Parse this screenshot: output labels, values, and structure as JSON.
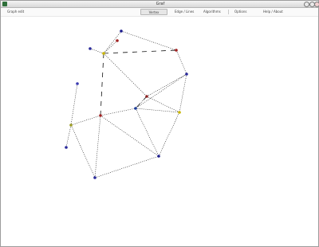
{
  "window": {
    "title": "Graf",
    "controls": [
      "minimize",
      "maximize",
      "close"
    ]
  },
  "toolbar": {
    "left_label": "Graph edit",
    "buttons": [
      {
        "label": "Vertex",
        "active": true
      },
      {
        "label": "Edge / Lines",
        "active": false
      },
      {
        "label": "Algorithms",
        "active": false
      },
      {
        "label": "Options",
        "active": false
      },
      {
        "label": "Help / About",
        "active": false
      }
    ]
  },
  "graph": {
    "vertices": [
      {
        "id": "v1",
        "color": "#1a1a8c"
      },
      {
        "id": "v2",
        "color": "#2a2a9a"
      },
      {
        "id": "v3",
        "color": "#c8b400"
      },
      {
        "id": "v4",
        "color": "#a02020"
      },
      {
        "id": "v5",
        "color": "#a02020"
      },
      {
        "id": "v6",
        "color": "#2a2a9a"
      },
      {
        "id": "v7",
        "color": "#3a3ab0"
      },
      {
        "id": "v8",
        "color": "#8a2020"
      },
      {
        "id": "v9",
        "color": "#1a3a9a"
      },
      {
        "id": "v10",
        "color": "#c8b400"
      },
      {
        "id": "v11",
        "color": "#a02020"
      },
      {
        "id": "v12",
        "color": "#9a9a20"
      },
      {
        "id": "v13",
        "color": "#2a2a9a"
      },
      {
        "id": "v14",
        "color": "#2a2a9a"
      },
      {
        "id": "v15",
        "color": "#1a1a8c"
      }
    ],
    "edges": [
      {
        "from": "v1",
        "to": "v5",
        "style": "dotted"
      },
      {
        "from": "v1",
        "to": "v3",
        "style": "dotted"
      },
      {
        "from": "v4",
        "to": "v3",
        "style": "dotted"
      },
      {
        "from": "v2",
        "to": "v3",
        "style": "dotted"
      },
      {
        "from": "v3",
        "to": "v5",
        "style": "dashed"
      },
      {
        "from": "v3",
        "to": "v11",
        "style": "dashed"
      },
      {
        "from": "v3",
        "to": "v8",
        "style": "dotted"
      },
      {
        "from": "v5",
        "to": "v6",
        "style": "dotted"
      },
      {
        "from": "v6",
        "to": "v10",
        "style": "dotted"
      },
      {
        "from": "v6",
        "to": "v9",
        "style": "dotted"
      },
      {
        "from": "v10",
        "to": "v15",
        "style": "dotted"
      },
      {
        "from": "v7",
        "to": "v12",
        "style": "dotted"
      },
      {
        "from": "v12",
        "to": "v13",
        "style": "dotted"
      },
      {
        "from": "v12",
        "to": "v14",
        "style": "dotted"
      },
      {
        "from": "v12",
        "to": "v11",
        "style": "dotted"
      },
      {
        "from": "v11",
        "to": "v14",
        "style": "dotted"
      },
      {
        "from": "v11",
        "to": "v9",
        "style": "dotted"
      },
      {
        "from": "v11",
        "to": "v15",
        "style": "dotted"
      },
      {
        "from": "v9",
        "to": "v10",
        "style": "dotted"
      },
      {
        "from": "v9",
        "to": "v8",
        "style": "dotted"
      },
      {
        "from": "v8",
        "to": "v10",
        "style": "dotted"
      },
      {
        "from": "v9",
        "to": "v15",
        "style": "dotted"
      },
      {
        "from": "v14",
        "to": "v15",
        "style": "dotted"
      },
      {
        "from": "v8",
        "to": "v6",
        "style": "dotted"
      },
      {
        "from": "v8",
        "to": "v9",
        "style": "dashed"
      }
    ]
  }
}
